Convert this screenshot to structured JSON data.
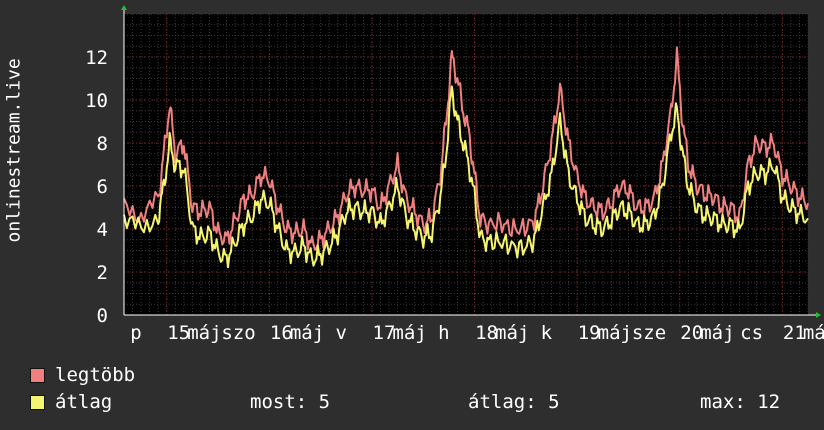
{
  "chart_data": {
    "type": "line",
    "ylabel": "onlinestream.live",
    "ylim": [
      0,
      14
    ],
    "yticks": [
      0,
      2,
      4,
      6,
      8,
      10,
      12
    ],
    "grid": true,
    "xtick_labels": [
      "p",
      "15",
      "máj",
      "szo",
      "16",
      "máj",
      "v",
      "17",
      "máj",
      "h",
      "18",
      "máj",
      "k",
      "19",
      "máj",
      "sze",
      "20",
      "máj",
      "cs",
      "21",
      "máj"
    ],
    "x_positions": [
      0,
      15,
      24,
      36,
      51,
      60,
      72,
      87,
      96,
      108,
      123,
      132,
      144,
      159,
      168,
      180,
      195,
      204,
      216,
      231,
      240
    ],
    "x_range": [
      0,
      240
    ],
    "series": [
      {
        "name": "legtöbb",
        "color": "#f07f7f",
        "keypoints": [
          [
            0,
            5.0
          ],
          [
            6,
            4.6
          ],
          [
            12,
            5.4
          ],
          [
            14,
            7.5
          ],
          [
            16,
            9.8
          ],
          [
            18,
            7.5
          ],
          [
            21,
            8.0
          ],
          [
            24,
            5.0
          ],
          [
            27,
            4.8
          ],
          [
            30,
            5.0
          ],
          [
            33,
            3.8
          ],
          [
            36,
            3.5
          ],
          [
            39,
            4.4
          ],
          [
            42,
            5.4
          ],
          [
            45,
            5.6
          ],
          [
            48,
            6.5
          ],
          [
            51,
            6.3
          ],
          [
            54,
            5.0
          ],
          [
            57,
            4.0
          ],
          [
            60,
            3.8
          ],
          [
            63,
            4.0
          ],
          [
            66,
            3.2
          ],
          [
            69,
            3.5
          ],
          [
            72,
            4.0
          ],
          [
            75,
            4.6
          ],
          [
            78,
            5.6
          ],
          [
            81,
            6.0
          ],
          [
            84,
            5.8
          ],
          [
            87,
            5.8
          ],
          [
            90,
            5.0
          ],
          [
            93,
            6.0
          ],
          [
            96,
            7.0
          ],
          [
            99,
            5.4
          ],
          [
            102,
            4.8
          ],
          [
            105,
            4.2
          ],
          [
            108,
            4.5
          ],
          [
            111,
            6.5
          ],
          [
            113,
            9.0
          ],
          [
            115,
            12.0
          ],
          [
            117,
            11.0
          ],
          [
            119,
            9.5
          ],
          [
            121,
            8.5
          ],
          [
            123,
            6.5
          ],
          [
            125,
            4.5
          ],
          [
            128,
            4.2
          ],
          [
            132,
            4.3
          ],
          [
            136,
            4.0
          ],
          [
            140,
            4.0
          ],
          [
            144,
            4.4
          ],
          [
            147,
            6.0
          ],
          [
            150,
            8.0
          ],
          [
            153,
            10.5
          ],
          [
            156,
            8.0
          ],
          [
            159,
            6.4
          ],
          [
            162,
            5.4
          ],
          [
            165,
            5.0
          ],
          [
            168,
            4.8
          ],
          [
            171,
            5.2
          ],
          [
            174,
            6.0
          ],
          [
            177,
            5.8
          ],
          [
            180,
            5.0
          ],
          [
            183,
            5.0
          ],
          [
            186,
            5.4
          ],
          [
            189,
            7.0
          ],
          [
            192,
            9.5
          ],
          [
            194,
            12.0
          ],
          [
            196,
            9.0
          ],
          [
            198,
            7.0
          ],
          [
            201,
            6.0
          ],
          [
            204,
            5.6
          ],
          [
            207,
            5.5
          ],
          [
            210,
            5.0
          ],
          [
            213,
            5.0
          ],
          [
            216,
            4.5
          ],
          [
            219,
            7.0
          ],
          [
            222,
            8.0
          ],
          [
            225,
            7.8
          ],
          [
            228,
            8.0
          ],
          [
            231,
            6.5
          ],
          [
            234,
            6.0
          ],
          [
            237,
            5.5
          ],
          [
            240,
            5.2
          ]
        ]
      },
      {
        "name": "átlag",
        "color": "#f4f46e",
        "keypoints": [
          [
            0,
            4.5
          ],
          [
            6,
            4.0
          ],
          [
            12,
            4.6
          ],
          [
            14,
            6.0
          ],
          [
            16,
            8.0
          ],
          [
            18,
            7.0
          ],
          [
            21,
            6.8
          ],
          [
            24,
            4.0
          ],
          [
            27,
            3.6
          ],
          [
            30,
            3.8
          ],
          [
            33,
            2.9
          ],
          [
            36,
            2.6
          ],
          [
            39,
            3.4
          ],
          [
            42,
            4.2
          ],
          [
            45,
            4.6
          ],
          [
            48,
            5.4
          ],
          [
            51,
            5.2
          ],
          [
            54,
            4.0
          ],
          [
            57,
            3.0
          ],
          [
            60,
            2.9
          ],
          [
            63,
            3.2
          ],
          [
            66,
            2.6
          ],
          [
            69,
            2.8
          ],
          [
            72,
            3.2
          ],
          [
            75,
            3.8
          ],
          [
            78,
            4.8
          ],
          [
            81,
            5.0
          ],
          [
            84,
            4.8
          ],
          [
            87,
            4.8
          ],
          [
            90,
            4.2
          ],
          [
            93,
            5.0
          ],
          [
            96,
            6.0
          ],
          [
            99,
            4.6
          ],
          [
            102,
            4.0
          ],
          [
            105,
            3.6
          ],
          [
            108,
            3.8
          ],
          [
            111,
            5.5
          ],
          [
            113,
            7.5
          ],
          [
            115,
            10.5
          ],
          [
            117,
            9.0
          ],
          [
            119,
            8.0
          ],
          [
            121,
            7.0
          ],
          [
            123,
            5.5
          ],
          [
            125,
            3.6
          ],
          [
            128,
            3.4
          ],
          [
            132,
            3.4
          ],
          [
            136,
            3.2
          ],
          [
            140,
            3.1
          ],
          [
            144,
            3.5
          ],
          [
            147,
            5.0
          ],
          [
            150,
            6.5
          ],
          [
            153,
            9.0
          ],
          [
            156,
            6.5
          ],
          [
            159,
            5.4
          ],
          [
            162,
            4.5
          ],
          [
            165,
            4.2
          ],
          [
            168,
            4.0
          ],
          [
            171,
            4.4
          ],
          [
            174,
            5.0
          ],
          [
            177,
            4.8
          ],
          [
            180,
            4.2
          ],
          [
            183,
            4.2
          ],
          [
            186,
            4.6
          ],
          [
            189,
            6.0
          ],
          [
            192,
            8.5
          ],
          [
            194,
            9.5
          ],
          [
            196,
            7.5
          ],
          [
            198,
            6.0
          ],
          [
            201,
            5.0
          ],
          [
            204,
            4.6
          ],
          [
            207,
            4.5
          ],
          [
            210,
            4.2
          ],
          [
            213,
            4.2
          ],
          [
            216,
            3.9
          ],
          [
            219,
            6.0
          ],
          [
            222,
            6.6
          ],
          [
            225,
            6.6
          ],
          [
            228,
            7.0
          ],
          [
            231,
            5.5
          ],
          [
            234,
            5.0
          ],
          [
            237,
            4.7
          ],
          [
            240,
            4.5
          ]
        ]
      }
    ]
  },
  "legend": {
    "items": [
      {
        "label": "legtöbb",
        "color": "#f07f7f"
      },
      {
        "label": "átlag",
        "color": "#f4f46e"
      }
    ]
  },
  "stats": {
    "current": "most: 5",
    "average": "átlag: 5",
    "max": "max: 12"
  }
}
